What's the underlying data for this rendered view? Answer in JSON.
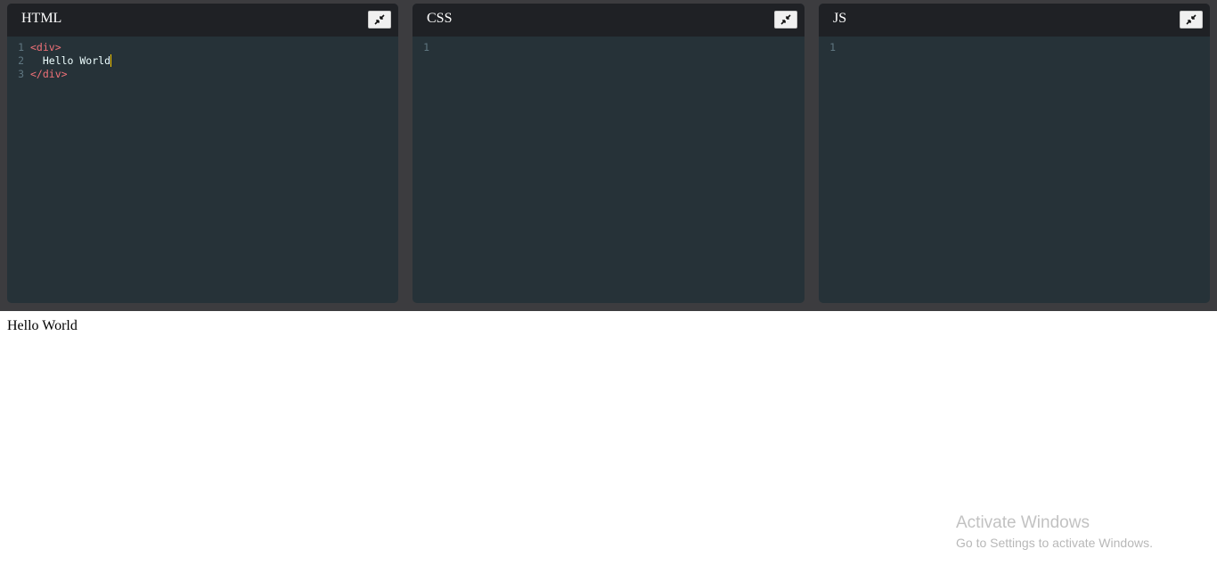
{
  "editors": [
    {
      "title": "HTML",
      "lines": [
        {
          "num": "1",
          "tag": "<div>",
          "text": ""
        },
        {
          "num": "2",
          "tag": "",
          "text": "  Hello World"
        },
        {
          "num": "3",
          "tag": "</div>",
          "text": ""
        }
      ]
    },
    {
      "title": "CSS",
      "lines": [
        {
          "num": "1",
          "tag": "",
          "text": ""
        }
      ]
    },
    {
      "title": "JS",
      "lines": [
        {
          "num": "1",
          "tag": "",
          "text": ""
        }
      ]
    }
  ],
  "minimize_icon": "minimize-arrows-icon",
  "output": {
    "text": "Hello World"
  },
  "watermark": {
    "title": "Activate Windows",
    "subtitle": "Go to Settings to activate Windows."
  },
  "colors": {
    "editor_bg": "#263238",
    "header_bg": "#1f2125",
    "pane_bg": "#3c3c3f",
    "tag": "#f07178",
    "gutter": "#5f7680",
    "cursor": "#ffcc00"
  }
}
